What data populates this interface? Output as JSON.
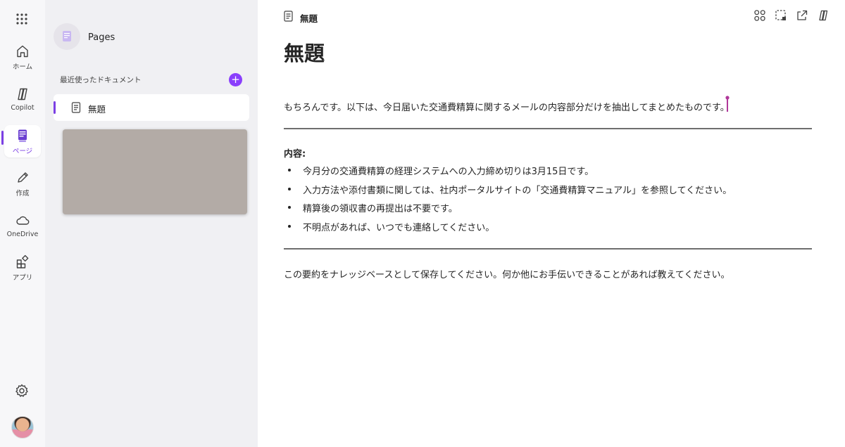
{
  "rail": {
    "items": [
      {
        "label": "ホーム",
        "icon": "home-icon"
      },
      {
        "label": "Copilot",
        "icon": "copilot-icon"
      },
      {
        "label": "ページ",
        "icon": "pages-icon",
        "active": true
      },
      {
        "label": "作成",
        "icon": "create-icon"
      },
      {
        "label": "OneDrive",
        "icon": "onedrive-icon"
      },
      {
        "label": "アプリ",
        "icon": "apps-icon"
      }
    ],
    "accent": "#7b3fe4"
  },
  "pane": {
    "title": "Pages",
    "recent_label": "最近使ったドキュメント",
    "add_label": "+",
    "items": [
      {
        "label": "無題"
      }
    ],
    "thumbnail_color": "#b3aba6"
  },
  "main": {
    "breadcrumb_title": "無題",
    "title": "無題",
    "intro": "もちろんです。以下は、今日届いた交通費精算に関するメールの内容部分だけを抽出してまとめたものです。",
    "section_heading": "内容:",
    "bullets": [
      "今月分の交通費精算の経理システムへの入力締め切りは3月15日です。",
      "入力方法や添付書類に関しては、社内ポータルサイトの「交通費精算マニュアル」を参照してください。",
      "精算後の領収書の再提出は不要です。",
      "不明点があれば、いつでも連絡してください。"
    ],
    "closing": "この要約をナレッジベースとして保存してください。何か他にお手伝いできることがあれば教えてください。",
    "toolbar_icons": [
      "components-icon",
      "select-region-icon",
      "share-icon",
      "copilot-icon"
    ]
  }
}
